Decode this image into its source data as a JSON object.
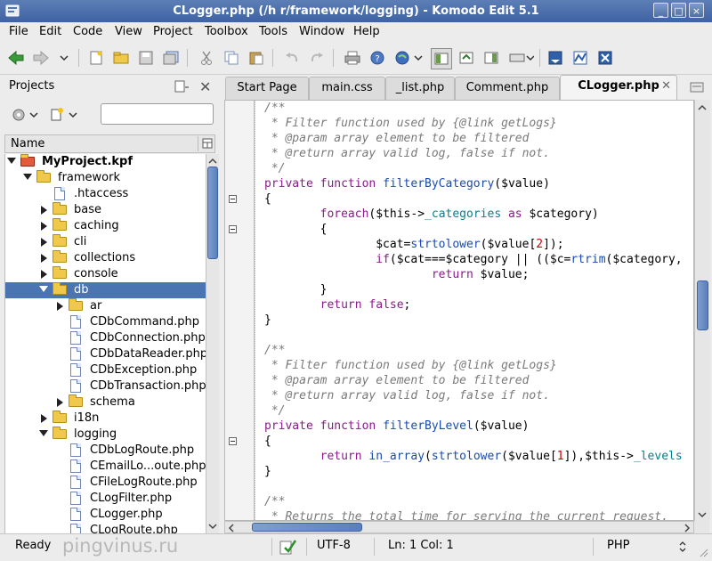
{
  "window": {
    "title": "CLogger.php (/h                          r/framework/logging) - Komodo Edit 5.1",
    "buttons": [
      "_",
      "□",
      "×"
    ]
  },
  "menu": [
    {
      "label": "File",
      "key": "F"
    },
    {
      "label": "Edit",
      "key": "E"
    },
    {
      "label": "Code",
      "key": "C"
    },
    {
      "label": "View",
      "key": "V"
    },
    {
      "label": "Project",
      "key": "P"
    },
    {
      "label": "Toolbox",
      "key": "b"
    },
    {
      "label": "Tools",
      "key": "T"
    },
    {
      "label": "Window",
      "key": "W"
    },
    {
      "label": "Help",
      "key": "H"
    }
  ],
  "toolbar": {
    "icons": [
      "back-arrow-icon",
      "forward-arrow-icon",
      "dropdown-icon",
      "new-file-icon",
      "open-folder-icon",
      "save-icon",
      "save-all-icon",
      "cut-icon",
      "copy-icon",
      "paste-icon",
      "undo-icon",
      "redo-icon",
      "print-icon",
      "help-icon",
      "browser-icon",
      "panel-left-icon",
      "panel-bottom-icon",
      "panel-right-icon",
      "layout-icon",
      "komodo-icon",
      "globe-icon",
      "extension-icon"
    ]
  },
  "projects_panel": {
    "title": "Projects",
    "column_header": "Name",
    "search_value": "",
    "tree": [
      {
        "label": "MyProject.kpf",
        "kind": "project",
        "expanded": true,
        "depth": 0,
        "bold": true
      },
      {
        "label": "framework",
        "kind": "folder",
        "expanded": true,
        "depth": 1
      },
      {
        "label": ".htaccess",
        "kind": "file",
        "depth": 2
      },
      {
        "label": "base",
        "kind": "folder",
        "expanded": false,
        "depth": 2
      },
      {
        "label": "caching",
        "kind": "folder",
        "expanded": false,
        "depth": 2
      },
      {
        "label": "cli",
        "kind": "folder",
        "expanded": false,
        "depth": 2
      },
      {
        "label": "collections",
        "kind": "folder",
        "expanded": false,
        "depth": 2
      },
      {
        "label": "console",
        "kind": "folder",
        "expanded": false,
        "depth": 2
      },
      {
        "label": "db",
        "kind": "folder",
        "expanded": true,
        "depth": 2,
        "selected": true
      },
      {
        "label": "ar",
        "kind": "folder",
        "expanded": false,
        "depth": 3
      },
      {
        "label": "CDbCommand.php",
        "kind": "file",
        "depth": 3
      },
      {
        "label": "CDbConnection.php",
        "kind": "file",
        "depth": 3
      },
      {
        "label": "CDbDataReader.php",
        "kind": "file",
        "depth": 3
      },
      {
        "label": "CDbException.php",
        "kind": "file",
        "depth": 3
      },
      {
        "label": "CDbTransaction.php",
        "kind": "file",
        "depth": 3
      },
      {
        "label": "schema",
        "kind": "folder",
        "expanded": false,
        "depth": 3
      },
      {
        "label": "i18n",
        "kind": "folder",
        "expanded": false,
        "depth": 2
      },
      {
        "label": "logging",
        "kind": "folder",
        "expanded": true,
        "depth": 2
      },
      {
        "label": "CDbLogRoute.php",
        "kind": "file",
        "depth": 3
      },
      {
        "label": "CEmailLo...oute.php",
        "kind": "file",
        "depth": 3
      },
      {
        "label": "CFileLogRoute.php",
        "kind": "file",
        "depth": 3
      },
      {
        "label": "CLogFilter.php",
        "kind": "file",
        "depth": 3
      },
      {
        "label": "CLogger.php",
        "kind": "file",
        "depth": 3
      },
      {
        "label": "CLogRoute.php",
        "kind": "file",
        "depth": 3
      }
    ]
  },
  "tabs": [
    {
      "label": "Start Page",
      "active": false
    },
    {
      "label": "main.css",
      "active": false
    },
    {
      "label": "_list.php",
      "active": false
    },
    {
      "label": "Comment.php",
      "active": false
    },
    {
      "label": "CLogger.php",
      "active": true
    }
  ],
  "code_lines": [
    {
      "fold": false,
      "tokens": [
        {
          "t": "/**",
          "c": "comment"
        }
      ]
    },
    {
      "fold": false,
      "tokens": [
        {
          "t": " * Filter function used by {@link getLogs}",
          "c": "comment"
        }
      ]
    },
    {
      "fold": false,
      "tokens": [
        {
          "t": " * @param array element to be filtered",
          "c": "comment"
        }
      ]
    },
    {
      "fold": false,
      "tokens": [
        {
          "t": " * @return array valid log, false if not.",
          "c": "comment"
        }
      ]
    },
    {
      "fold": false,
      "tokens": [
        {
          "t": " */",
          "c": "comment"
        }
      ]
    },
    {
      "fold": false,
      "tokens": [
        {
          "t": "private function ",
          "c": "kw"
        },
        {
          "t": "filterByCategory",
          "c": "fn"
        },
        {
          "t": "($value)",
          "c": "plain"
        }
      ]
    },
    {
      "fold": true,
      "tokens": [
        {
          "t": "{",
          "c": "plain"
        }
      ]
    },
    {
      "fold": false,
      "tokens": [
        {
          "t": "        ",
          "c": "plain"
        },
        {
          "t": "foreach",
          "c": "kw"
        },
        {
          "t": "($this->",
          "c": "plain"
        },
        {
          "t": "_categories",
          "c": "prop"
        },
        {
          "t": " as ",
          "c": "kw"
        },
        {
          "t": "$category)",
          "c": "plain"
        }
      ]
    },
    {
      "fold": true,
      "tokens": [
        {
          "t": "        {",
          "c": "plain"
        }
      ]
    },
    {
      "fold": false,
      "tokens": [
        {
          "t": "                $cat=",
          "c": "plain"
        },
        {
          "t": "strtolower",
          "c": "fn"
        },
        {
          "t": "($value[",
          "c": "plain"
        },
        {
          "t": "2",
          "c": "num"
        },
        {
          "t": "]);",
          "c": "plain"
        }
      ]
    },
    {
      "fold": false,
      "tokens": [
        {
          "t": "                ",
          "c": "plain"
        },
        {
          "t": "if",
          "c": "kw"
        },
        {
          "t": "($cat===$category || (($c=",
          "c": "plain"
        },
        {
          "t": "rtrim",
          "c": "fn"
        },
        {
          "t": "($category,",
          "c": "plain"
        }
      ]
    },
    {
      "fold": false,
      "tokens": [
        {
          "t": "                        ",
          "c": "plain"
        },
        {
          "t": "return",
          "c": "kw"
        },
        {
          "t": " $value;",
          "c": "plain"
        }
      ]
    },
    {
      "fold": false,
      "tokens": [
        {
          "t": "        }",
          "c": "plain"
        }
      ]
    },
    {
      "fold": false,
      "tokens": [
        {
          "t": "        ",
          "c": "plain"
        },
        {
          "t": "return false",
          "c": "kw"
        },
        {
          "t": ";",
          "c": "plain"
        }
      ]
    },
    {
      "fold": false,
      "tokens": [
        {
          "t": "}",
          "c": "plain"
        }
      ]
    },
    {
      "fold": false,
      "tokens": []
    },
    {
      "fold": false,
      "tokens": [
        {
          "t": "/**",
          "c": "comment"
        }
      ]
    },
    {
      "fold": false,
      "tokens": [
        {
          "t": " * Filter function used by {@link getLogs}",
          "c": "comment"
        }
      ]
    },
    {
      "fold": false,
      "tokens": [
        {
          "t": " * @param array element to be filtered",
          "c": "comment"
        }
      ]
    },
    {
      "fold": false,
      "tokens": [
        {
          "t": " * @return array valid log, false if not.",
          "c": "comment"
        }
      ]
    },
    {
      "fold": false,
      "tokens": [
        {
          "t": " */",
          "c": "comment"
        }
      ]
    },
    {
      "fold": false,
      "tokens": [
        {
          "t": "private function ",
          "c": "kw"
        },
        {
          "t": "filterByLevel",
          "c": "fn"
        },
        {
          "t": "($value)",
          "c": "plain"
        }
      ]
    },
    {
      "fold": true,
      "tokens": [
        {
          "t": "{",
          "c": "plain"
        }
      ]
    },
    {
      "fold": false,
      "tokens": [
        {
          "t": "        ",
          "c": "plain"
        },
        {
          "t": "return ",
          "c": "kw"
        },
        {
          "t": "in_array",
          "c": "fn"
        },
        {
          "t": "(",
          "c": "plain"
        },
        {
          "t": "strtolower",
          "c": "fn"
        },
        {
          "t": "($value[",
          "c": "plain"
        },
        {
          "t": "1",
          "c": "num"
        },
        {
          "t": "]),$this->",
          "c": "plain"
        },
        {
          "t": "_levels",
          "c": "prop"
        }
      ]
    },
    {
      "fold": false,
      "tokens": [
        {
          "t": "}",
          "c": "plain"
        }
      ]
    },
    {
      "fold": false,
      "tokens": []
    },
    {
      "fold": false,
      "tokens": [
        {
          "t": "/**",
          "c": "comment"
        }
      ]
    },
    {
      "fold": false,
      "tokens": [
        {
          "t": " * Returns the total time for serving the current request.",
          "c": "comment"
        }
      ]
    }
  ],
  "statusbar": {
    "status": "Ready",
    "encoding": "UTF-8",
    "position": "Ln: 1 Col: 1",
    "language": "PHP",
    "watermark": "pingvinus.ru"
  },
  "colors": {
    "titlebar": "#4a6fae",
    "selection": "#4a74b2",
    "comment": "#7a7a7a",
    "keyword": "#8b1a8b",
    "function": "#1a4bb0"
  }
}
